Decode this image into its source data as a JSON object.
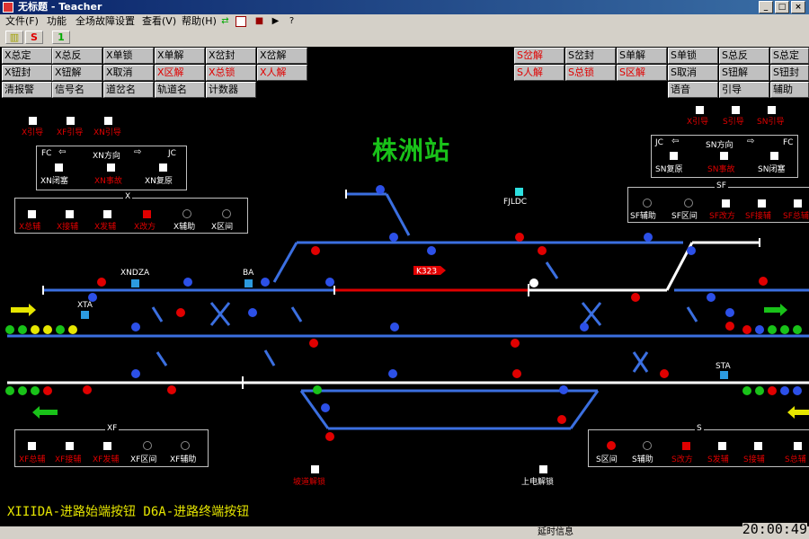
{
  "window": {
    "title": "无标题 - Teacher",
    "min": "_",
    "max": "□",
    "close": "×"
  },
  "menu": {
    "items": [
      "文件(F)",
      "功能",
      "全场故障设置",
      "查看(V)",
      "帮助(H)"
    ]
  },
  "toolbar": {
    "btn1": "S",
    "btn2": "1"
  },
  "left_buttons": [
    [
      "X总定",
      "X总反",
      "X单锁",
      "X单解",
      "X岔封",
      "X岔解"
    ],
    [
      "X钮封",
      "X钮解",
      "X取消",
      "X区解",
      "X总锁",
      "X人解"
    ],
    [
      "清报警",
      "信号名",
      "道岔名",
      "轨道名",
      "计数器"
    ]
  ],
  "right_buttons": [
    [
      "S岔解",
      "S岔封",
      "S单解",
      "S单锁",
      "S总反",
      "S总定"
    ],
    [
      "S人解",
      "S总锁",
      "S区解",
      "S取消",
      "S钮解",
      "S钮封"
    ],
    [
      "语音",
      "引导",
      "辅助"
    ]
  ],
  "station_name": "株洲站",
  "top_left_labels": [
    "X引导",
    "XF引导",
    "XN引导"
  ],
  "top_right_labels": [
    "X引导",
    "S引导",
    "SN引导"
  ],
  "xn_panel": {
    "fc": "FC",
    "dir": "XN方向",
    "jc": "JC",
    "items": [
      "XN闭塞",
      "XN事故",
      "XN复原"
    ]
  },
  "sn_panel": {
    "jc": "JC",
    "dir": "SN方向",
    "fc": "FC",
    "items": [
      "SN复原",
      "SN事故",
      "SN闭塞"
    ]
  },
  "x_panel": {
    "title": "X",
    "items": [
      "X总辅",
      "X接辅",
      "X发辅",
      "X改方",
      "X辅助",
      "X区间"
    ]
  },
  "sf_panel": {
    "title": "SF",
    "items": [
      "SF辅助",
      "SF区间",
      "SF改方",
      "SF接辅",
      "SF总辅"
    ]
  },
  "xf_panel": {
    "title": "XF",
    "items": [
      "XF总辅",
      "XF接辅",
      "XF发辅",
      "XF区间",
      "XF辅助"
    ]
  },
  "s_panel": {
    "title": "S",
    "items": [
      "S区间",
      "S辅助",
      "S改方",
      "S发辅",
      "S接辅",
      "S总辅"
    ]
  },
  "track_labels": {
    "xndza": "XNDZA",
    "ba": "BA",
    "xta": "XTA",
    "sta": "STA",
    "fjldc": "FJLDC"
  },
  "train_tag": "K323",
  "bottom_labels": {
    "ground_unlock": "坡道解锁",
    "power_unlock": "上电解锁"
  },
  "hint_text": "XIIIDA-进路始端按钮 D6A-进路终端按钮",
  "status": {
    "info": "延时信息",
    "clock": "20:00:49"
  },
  "colors": {
    "track": "#3b6fe0",
    "route_white": "#ffffff",
    "route_red": "#e00000",
    "title_green": "#19c219"
  }
}
